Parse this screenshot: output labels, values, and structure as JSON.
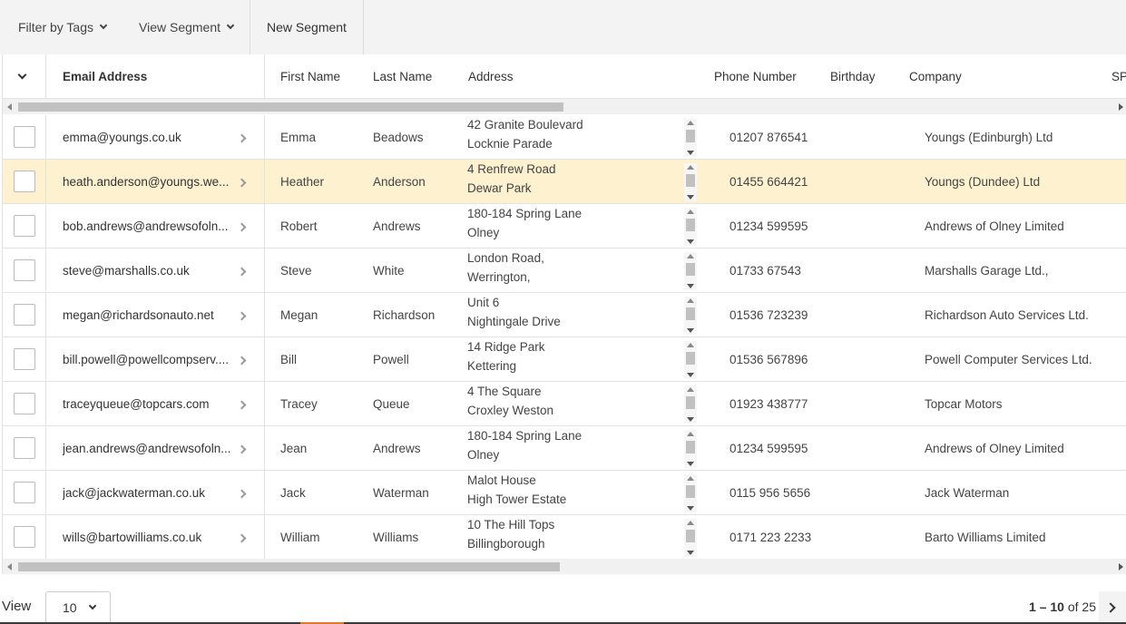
{
  "toolbar": {
    "filter_label": "Filter by Tags",
    "segment_label": "View Segment",
    "new_segment_label": "New Segment"
  },
  "columns": {
    "email": "Email Address",
    "first": "First Name",
    "last": "Last Name",
    "address": "Address",
    "phone": "Phone Number",
    "birthday": "Birthday",
    "company": "Company",
    "next_partial": "SP"
  },
  "rows": [
    {
      "email": "emma@youngs.co.uk",
      "first": "Emma",
      "last": "Beadows",
      "addr1": "42 Granite Boulevard",
      "addr2": "Locknie Parade",
      "phone": "01207 876541",
      "company": "Youngs (Edinburgh) Ltd"
    },
    {
      "email": "heath.anderson@youngs.we...",
      "first": "Heather",
      "last": "Anderson",
      "addr1": "4 Renfrew Road",
      "addr2": "Dewar Park",
      "phone": "01455 664421",
      "company": "Youngs (Dundee) Ltd"
    },
    {
      "email": "bob.andrews@andrewsofoln...",
      "first": "Robert",
      "last": "Andrews",
      "addr1": "180-184 Spring Lane",
      "addr2": "Olney",
      "phone": "01234 599595",
      "company": "Andrews of Olney Limited"
    },
    {
      "email": "steve@marshalls.co.uk",
      "first": "Steve",
      "last": "White",
      "addr1": "London Road,",
      "addr2": "Werrington,",
      "phone": "01733 67543",
      "company": "Marshalls Garage Ltd.,"
    },
    {
      "email": "megan@richardsonauto.net",
      "first": "Megan",
      "last": "Richardson",
      "addr1": "Unit 6",
      "addr2": "Nightingale Drive",
      "phone": "01536 723239",
      "company": "Richardson Auto Services Ltd."
    },
    {
      "email": "bill.powell@powellcompserv....",
      "first": "Bill",
      "last": "Powell",
      "addr1": "14 Ridge Park",
      "addr2": "Kettering",
      "phone": "01536 567896",
      "company": "Powell Computer Services Ltd."
    },
    {
      "email": "traceyqueue@topcars.com",
      "first": "Tracey",
      "last": "Queue",
      "addr1": "4 The Square",
      "addr2": "Croxley Weston",
      "phone": "01923 438777",
      "company": "Topcar Motors"
    },
    {
      "email": "jean.andrews@andrewsofoln...",
      "first": "Jean",
      "last": "Andrews",
      "addr1": "180-184 Spring Lane",
      "addr2": "Olney",
      "phone": "01234 599595",
      "company": "Andrews of Olney Limited"
    },
    {
      "email": "jack@jackwaterman.co.uk",
      "first": "Jack",
      "last": "Waterman",
      "addr1": "Malot House",
      "addr2": "High Tower Estate",
      "phone": "0115 956 5656",
      "company": "Jack Waterman"
    },
    {
      "email": "wills@bartowilliams.co.uk",
      "first": "William",
      "last": "Williams",
      "addr1": "10 The Hill Tops",
      "addr2": "Billingborough",
      "phone": "0171 223 2233",
      "company": "Barto Williams Limited"
    }
  ],
  "footer": {
    "view_label": "View",
    "page_size": "10",
    "range": "1 – 10",
    "of_label": "of 25"
  },
  "colors": {
    "highlight_row": "#fdf1cf",
    "toolbar_bg": "#f3f3f3"
  }
}
